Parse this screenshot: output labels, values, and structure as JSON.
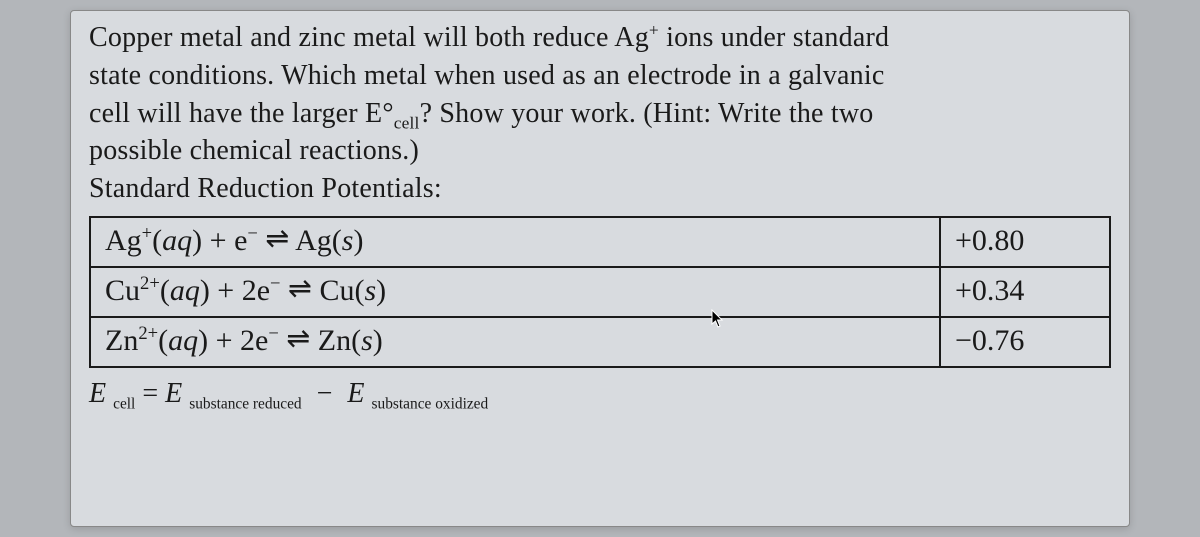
{
  "question": {
    "line1_html": "Copper metal and zinc metal will both reduce Ag<sup>+</sup> ions under standard",
    "line2_html": "state conditions. Which metal when used as an electrode in a galvanic",
    "line3_html": "cell will have the larger E°<sub>cell</sub>? Show your work. (Hint: Write the two",
    "line4": "possible chemical reactions.)",
    "line5": "Standard Reduction Potentials:"
  },
  "table": [
    {
      "reaction_html": "Ag<sup>+</sup>(<span class='it'>aq</span>) + e<sup>−</sup> <span class='arrow'>⇌</span> Ag(<span class='it'>s</span>)",
      "potential": "+0.80"
    },
    {
      "reaction_html": "Cu<sup>2+</sup>(<span class='it'>aq</span>) + 2e<sup>−</sup> <span class='arrow'>⇌</span> Cu(<span class='it'>s</span>)",
      "potential": "+0.34"
    },
    {
      "reaction_html": "Zn<sup>2+</sup>(<span class='it'>aq</span>) + 2e<sup>−</sup> <span class='arrow'>⇌</span> Zn(<span class='it'>s</span>)",
      "potential": "−0.76"
    }
  ],
  "formula": {
    "E": "E",
    "cell": "cell",
    "eq": " = ",
    "sub_red": "substance reduced",
    "minus": "−",
    "sub_ox": "substance oxidized"
  }
}
